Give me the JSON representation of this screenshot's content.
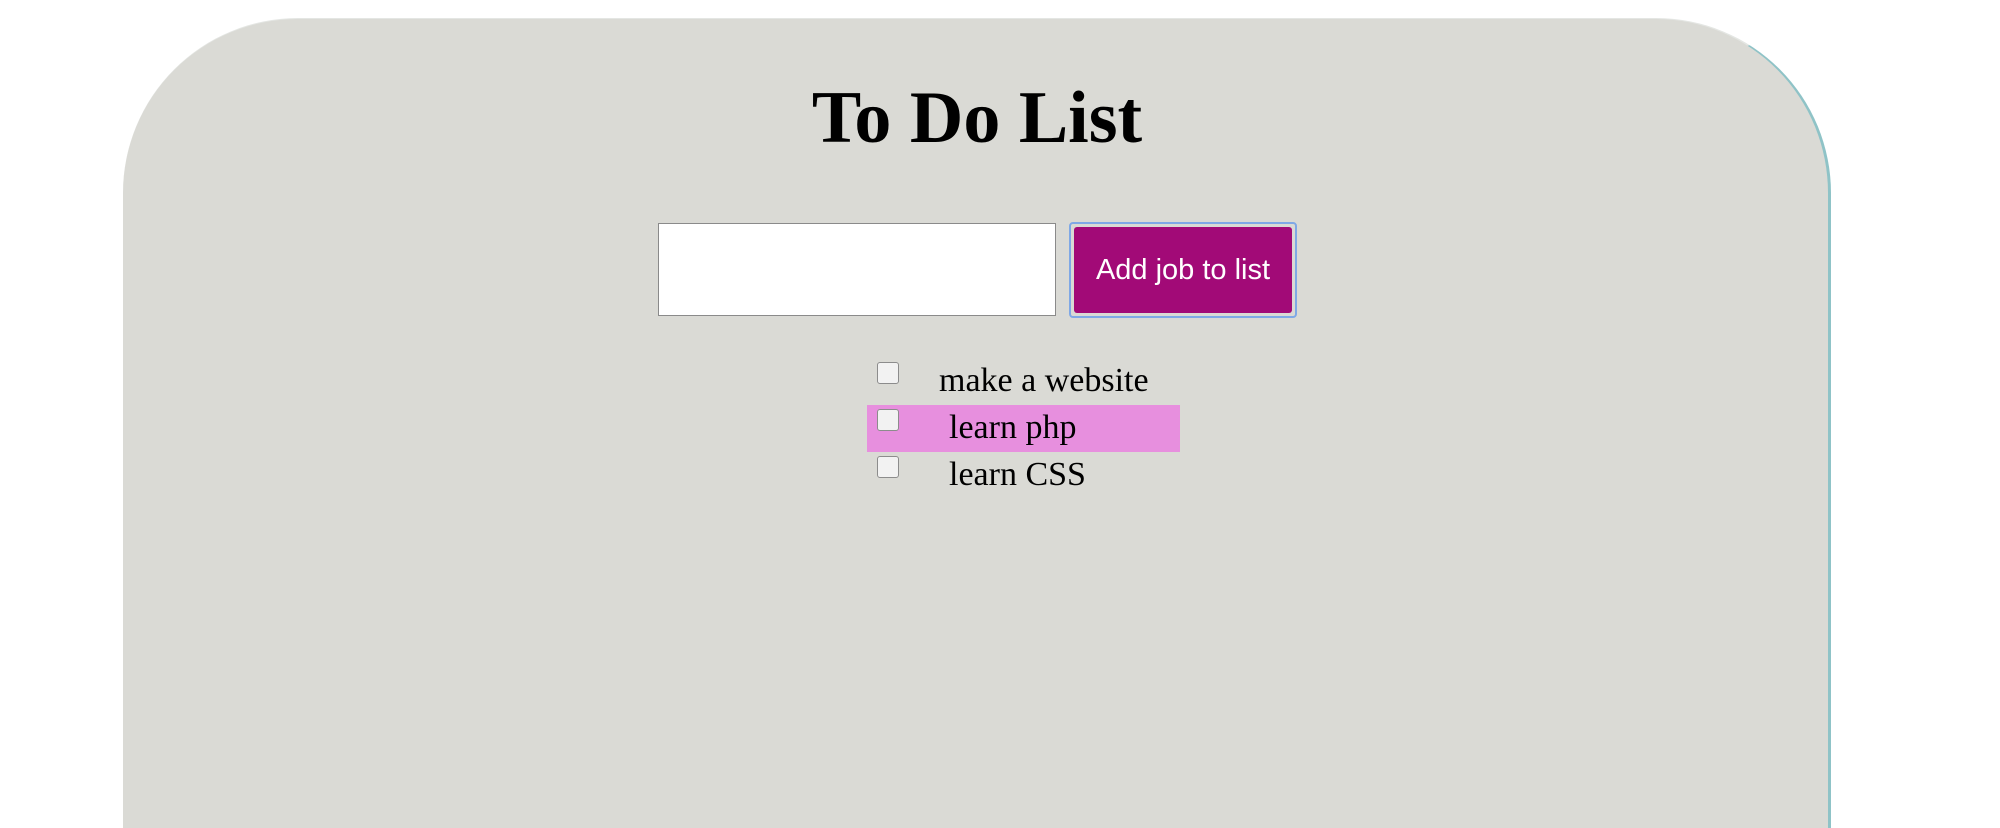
{
  "page": {
    "title": "To Do List"
  },
  "form": {
    "input_value": "",
    "input_placeholder": "",
    "add_button_label": "Add job to list"
  },
  "todos": [
    {
      "label": "make a website",
      "checked": false,
      "highlighted": false
    },
    {
      "label": "learn php",
      "checked": false,
      "highlighted": true
    },
    {
      "label": "learn CSS",
      "checked": false,
      "highlighted": false
    }
  ],
  "colors": {
    "card_background": "#dadad5",
    "button_background": "#a20a77",
    "button_text": "#ffffff",
    "highlight": "#e78fde",
    "card_edge": "#8fc3c7"
  }
}
